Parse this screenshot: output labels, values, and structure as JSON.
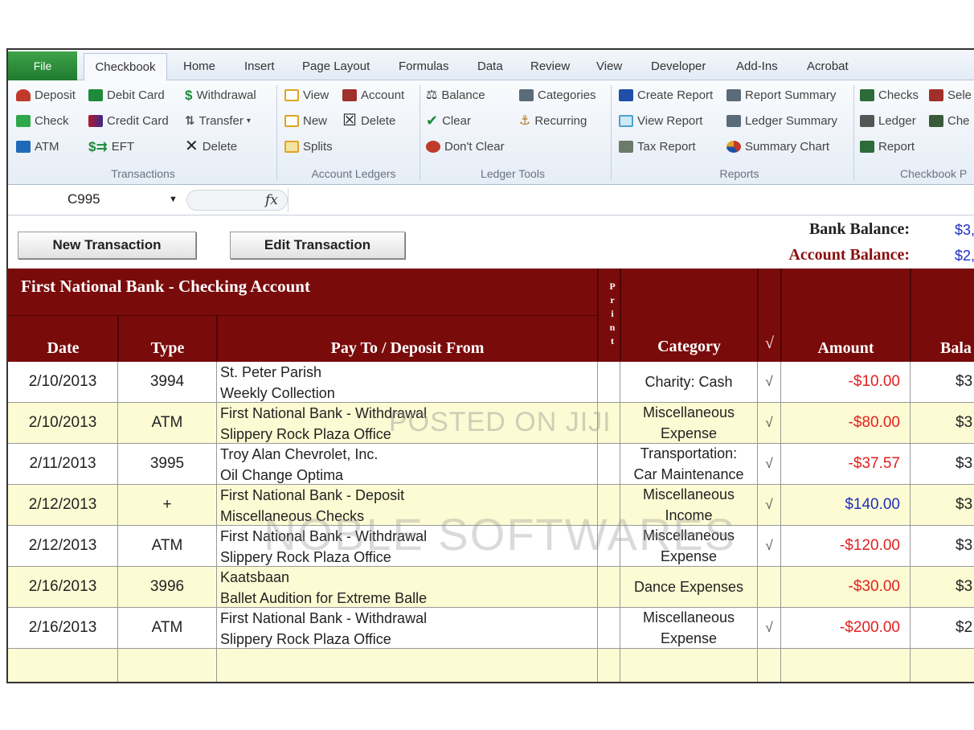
{
  "ribbon_tabs": {
    "file": "File",
    "active": "Checkbook",
    "others": [
      "Home",
      "Insert",
      "Page Layout",
      "Formulas",
      "Data",
      "Review",
      "View",
      "Developer",
      "Add-Ins",
      "Acrobat"
    ]
  },
  "ribbon": {
    "transactions": {
      "deposit": "Deposit",
      "debit_card": "Debit Card",
      "withdrawal": "Withdrawal",
      "check": "Check",
      "credit_card": "Credit Card",
      "transfer": "Transfer",
      "atm": "ATM",
      "eft": "EFT",
      "delete": "Delete",
      "label": "Transactions"
    },
    "account_ledgers": {
      "view": "View",
      "account": "Account",
      "new": "New",
      "delete": "Delete",
      "splits": "Splits",
      "label": "Account Ledgers"
    },
    "ledger_tools": {
      "balance": "Balance",
      "categories": "Categories",
      "clear": "Clear",
      "recurring": "Recurring",
      "dont_clear": "Don't Clear",
      "label": "Ledger Tools"
    },
    "reports": {
      "create_report": "Create Report",
      "report_summary": "Report Summary",
      "view_report": "View Report",
      "ledger_summary": "Ledger Summary",
      "tax_report": "Tax Report",
      "summary_chart": "Summary Chart",
      "label": "Reports"
    },
    "checkbook": {
      "checks": "Checks",
      "sele": "Sele",
      "ledger": "Ledger",
      "che": "Che",
      "report": "Report",
      "label": "Checkbook P"
    }
  },
  "formula_bar": {
    "name_box": "C995",
    "fx": "fx"
  },
  "buttons": {
    "new_transaction": "New Transaction",
    "edit_transaction": "Edit Transaction"
  },
  "balances": {
    "bank_label": "Bank Balance:",
    "bank_value": "$3,",
    "account_label": "Account Balance:",
    "account_value": "$2,"
  },
  "register": {
    "title": "First National Bank - Checking Account",
    "columns": {
      "date": "Date",
      "type": "Type",
      "payee": "Pay To / Deposit From",
      "print": "Print",
      "category": "Category",
      "check": "√",
      "amount": "Amount",
      "balance": "Bala"
    },
    "rows": [
      {
        "date": "2/10/2013",
        "type": "3994",
        "payee1": "St. Peter Parish",
        "payee2": "Weekly Collection",
        "category": "Charity: Cash",
        "cleared": "√",
        "amount": "-$10.00",
        "balance": "$3,"
      },
      {
        "date": "2/10/2013",
        "type": "ATM",
        "payee1": "First National Bank - Withdrawal",
        "payee2": "Slippery Rock Plaza Office",
        "category": "Miscellaneous\nExpense",
        "cleared": "√",
        "amount": "-$80.00",
        "balance": "$3,"
      },
      {
        "date": "2/11/2013",
        "type": "3995",
        "payee1": "Troy Alan Chevrolet, Inc.",
        "payee2": "Oil Change Optima",
        "category": "Transportation:\nCar Maintenance",
        "cleared": "√",
        "amount": "-$37.57",
        "balance": "$3,"
      },
      {
        "date": "2/12/2013",
        "type": "+",
        "payee1": "First National Bank - Deposit",
        "payee2": "Miscellaneous Checks",
        "category": "Miscellaneous\nIncome",
        "cleared": "√",
        "amount": "$140.00",
        "balance": "$3,"
      },
      {
        "date": "2/12/2013",
        "type": "ATM",
        "payee1": "First National Bank - Withdrawal",
        "payee2": "Slippery Rock Plaza Office",
        "category": "Miscellaneous\nExpense",
        "cleared": "√",
        "amount": "-$120.00",
        "balance": "$3,"
      },
      {
        "date": "2/16/2013",
        "type": "3996",
        "payee1": "Kaatsbaan",
        "payee2": "Ballet Audition for Extreme Balle",
        "category": "Dance Expenses",
        "cleared": "",
        "amount": "-$30.00",
        "balance": "$3,"
      },
      {
        "date": "2/16/2013",
        "type": "ATM",
        "payee1": "First National Bank - Withdrawal",
        "payee2": "Slippery Rock Plaza Office",
        "category": "Miscellaneous\nExpense",
        "cleared": "√",
        "amount": "-$200.00",
        "balance": "$2,"
      }
    ]
  },
  "watermarks": {
    "line1": "POSTED ON JIJI",
    "line2": "NOBLE SOFTWARES"
  },
  "colors": {
    "header": "#7a0b0b",
    "row_yellow": "#fdfbd3",
    "negative": "#e02020",
    "positive": "#1f2fbf",
    "file_tab": "#2f8f3c"
  }
}
